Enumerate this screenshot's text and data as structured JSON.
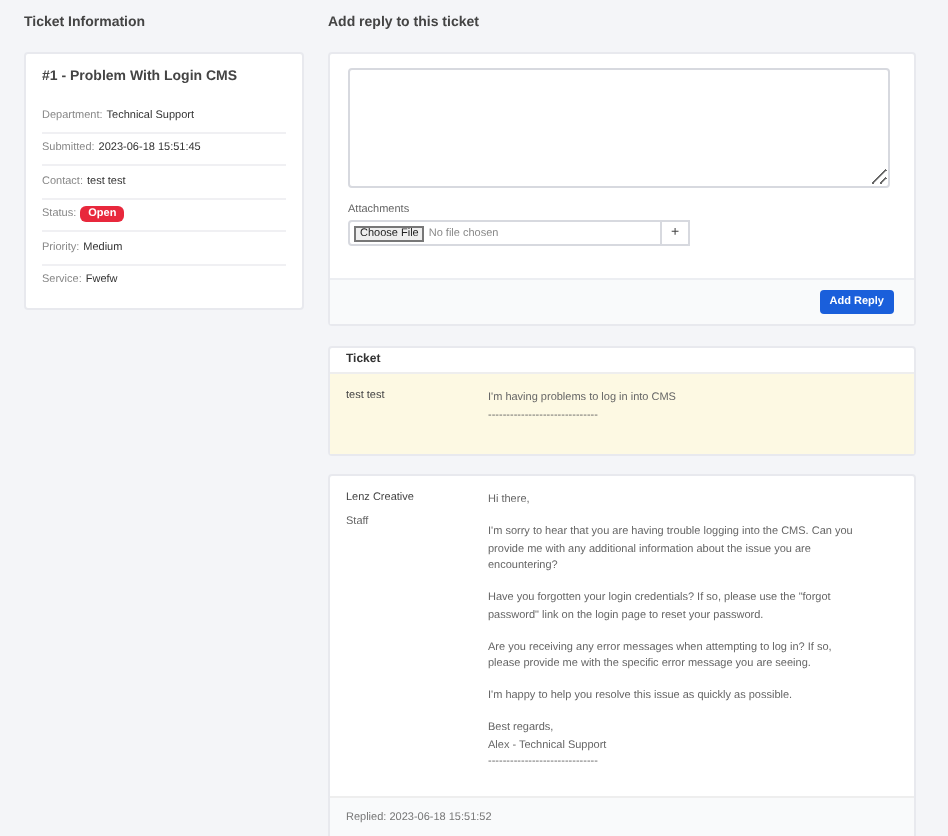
{
  "ticket_info": {
    "heading": "Ticket Information",
    "title": "#1 - Problem With Login CMS",
    "fields": [
      {
        "kind": "text",
        "label": "Department:",
        "value": "Technical Support"
      },
      {
        "kind": "text",
        "label": "Submitted:",
        "value": "2023-06-18 15:51:45"
      },
      {
        "kind": "text",
        "label": "Contact:",
        "value": "test test"
      },
      {
        "kind": "badge",
        "label": "Status:",
        "value": "Open"
      },
      {
        "kind": "text",
        "label": "Priority:",
        "value": "Medium"
      },
      {
        "kind": "text",
        "label": "Service:",
        "value": "Fwefw"
      }
    ]
  },
  "reply_form": {
    "heading": "Add reply to this ticket",
    "attachments_label": "Attachments",
    "file_button": "Choose File",
    "file_status": "No file chosen",
    "add_button": "+",
    "submit": "Add Reply"
  },
  "ticket": {
    "heading": "Ticket",
    "author": "test test",
    "paragraphs": [
      [
        "I'm having problems to log in into CMS",
        "------------------------------"
      ]
    ]
  },
  "reply": {
    "author": "Lenz Creative",
    "role": "Staff",
    "paragraphs": [
      [
        "Hi there,"
      ],
      [
        "I'm sorry to hear that you are having trouble logging into the CMS. Can you provide me with any additional information about the issue you are encountering?"
      ],
      [
        "Have you forgotten your login credentials? If so, please use the \"forgot password\" link on the login page to reset your password."
      ],
      [
        "Are you receiving any error messages when attempting to log in? If so, please provide me with the specific error message you are seeing."
      ],
      [
        "I'm happy to help you resolve this issue as quickly as possible."
      ],
      [
        "Best regards,",
        "Alex - Technical Support",
        "------------------------------"
      ]
    ],
    "footer": "Replied: 2023-06-18 15:51:52"
  }
}
